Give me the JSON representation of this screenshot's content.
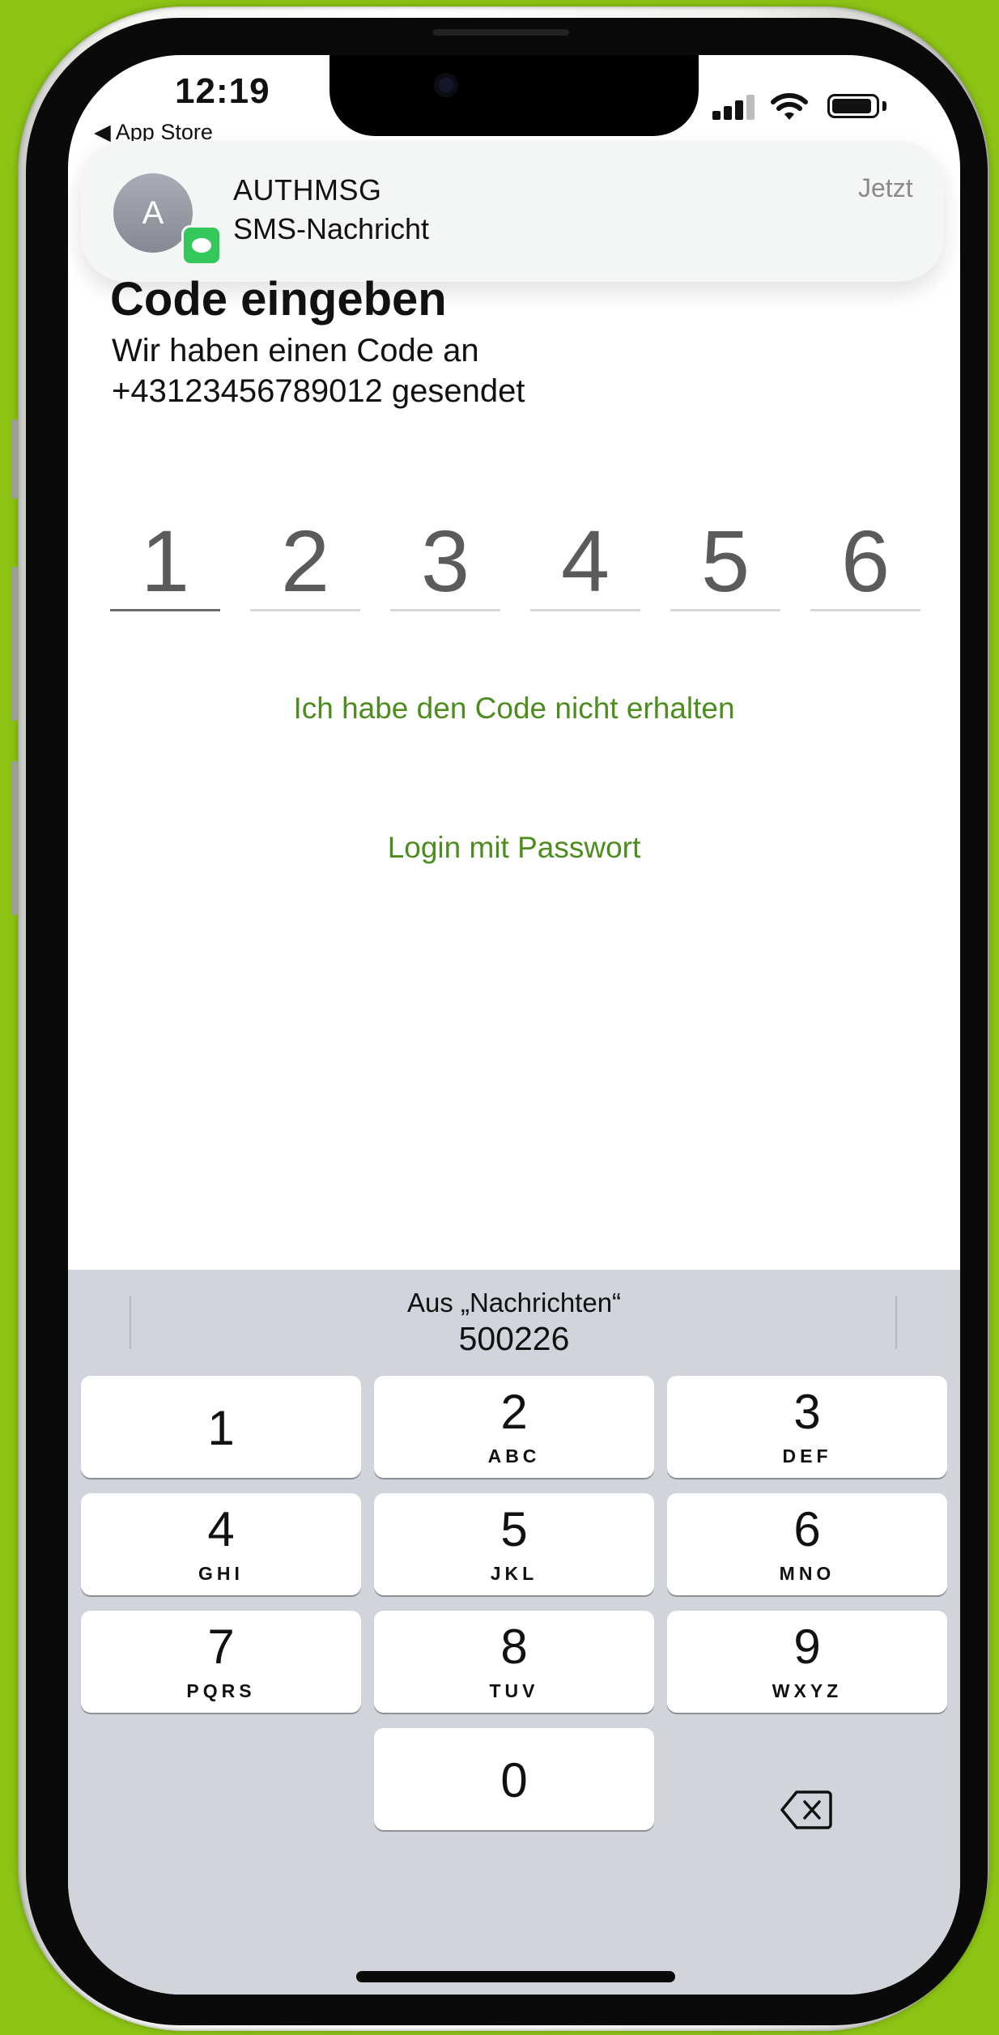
{
  "status_bar": {
    "time": "12:19",
    "back_label": "◀ App Store"
  },
  "notification": {
    "avatar_letter": "A",
    "sender": "AUTHMSG",
    "type": "SMS-Nachricht",
    "time": "Jetzt"
  },
  "page": {
    "title": "Code eingeben",
    "subtitle_line1": "Wir haben einen Code an",
    "subtitle_line2": "+43123456789012  gesendet"
  },
  "code_digits": [
    "1",
    "2",
    "3",
    "4",
    "5",
    "6"
  ],
  "links": {
    "no_code": "Ich habe den Code nicht erhalten",
    "password_login": "Login mit Passwort"
  },
  "keyboard": {
    "suggestion_source": "Aus „Nachrichten“",
    "suggestion_code": "500226",
    "keys": [
      {
        "num": "1",
        "letters": ""
      },
      {
        "num": "2",
        "letters": "ABC"
      },
      {
        "num": "3",
        "letters": "DEF"
      },
      {
        "num": "4",
        "letters": "GHI"
      },
      {
        "num": "5",
        "letters": "JKL"
      },
      {
        "num": "6",
        "letters": "MNO"
      },
      {
        "num": "7",
        "letters": "PQRS"
      },
      {
        "num": "8",
        "letters": "TUV"
      },
      {
        "num": "9",
        "letters": "WXYZ"
      },
      {
        "num": "0",
        "letters": ""
      }
    ],
    "delete_icon": "backspace-icon"
  },
  "colors": {
    "background": "#8cc314",
    "link_green": "#4d8c1e",
    "keyboard_bg": "#d1d4da"
  }
}
